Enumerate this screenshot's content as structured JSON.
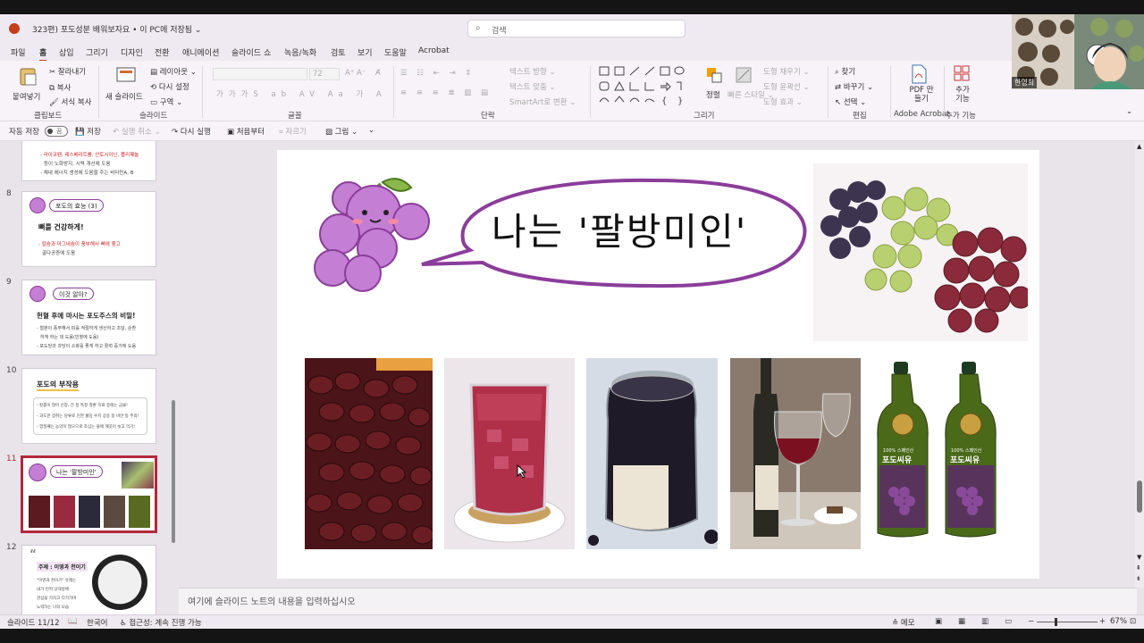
{
  "window": {
    "title": "323편) 포도성분 배워보자요 • 이 PC에 저장됨 ⌄",
    "search_placeholder": "검색"
  },
  "menu": [
    "파일",
    "홈",
    "삽입",
    "그리기",
    "디자인",
    "전환",
    "애니메이션",
    "슬라이드 쇼",
    "녹음/녹화",
    "검토",
    "보기",
    "도움말",
    "Acrobat"
  ],
  "ribbon": {
    "paste": "붙여넣기",
    "cut": "잘라내기",
    "copy": "복사",
    "format_painter": "서식 복사",
    "new_slide": "새 슬라이드",
    "layout": "레이아웃 ⌄",
    "reset": "다시 설정",
    "section": "구역 ⌄",
    "font_size": "72",
    "text_direction": "텍스트 방향 ⌄",
    "align_text": "텍스트 맞춤 ⌄",
    "smartart": "SmartArt로 변환 ⌄",
    "arrange": "정렬",
    "quick_styles": "빠른 스타일 ⌄",
    "shape_fill": "도형 채우기 ⌄",
    "shape_outline": "도형 윤곽선 ⌄",
    "shape_effects": "도형 효과 ⌄",
    "find": "찾기",
    "replace": "바꾸기 ⌄",
    "select": "선택 ⌄",
    "pdf": "PDF 만들기",
    "addins": "추가 기능",
    "groups": {
      "clipboard": "클립보드",
      "slides": "슬라이드",
      "font": "글꼴",
      "paragraph": "단락",
      "drawing": "그리기",
      "editing": "편집",
      "acrobat": "Adobe Acrobat",
      "addins": "추가 기능"
    }
  },
  "qat": {
    "autosave": "자동 저장",
    "autosave_state": "끔",
    "save": "저장",
    "undo": "실행 취소",
    "redo": "다시 실행",
    "from_start": "처음부터",
    "crop": "자르기",
    "picture": "그림"
  },
  "thumbs": {
    "t7_line1": "- 라이코펜, 레스베라트롤, 안토시아닌, 폴리페놀",
    "t7_line2": "등이 노화방지, 시력 개선에 도움",
    "t7_line3": "- 체내 에너지 생성에 도움을 주는 비타민A, B",
    "n8": "8",
    "t8_pill": "포도의 효능 (3)",
    "t8_head": "뼈를 건강하게!",
    "t8_line1": "- 칼슘과 마그네슘이 풍부해서 뼈에 좋고",
    "t8_line2": "골다공증에 도움",
    "n9": "9",
    "t9_pill": "이것 알아?",
    "t9_head": "헌혈 후에 마시는 포도주스의 비밀!",
    "t9_line1": "- 철분이 풍부해서 피를 적절하게 생산하고 조달, 순환",
    "t9_line2": "하게 하는 데 도움(빈혈에 도움)",
    "t9_line3": "- 포도당과 과당이 소화를 좋게 하고 활력 증가에 도움",
    "n10": "10",
    "t10_head": "포도의 부작용",
    "t10_line1": "- 칼륨이 많아 신장, 간 등 특정 질환 치료 중에는 금물!",
    "t10_line2": "- 과도한 섭취는 당류로 인한 혈당 수치 상승 등 비만 등 주의!",
    "t10_line3": "- 껍질째는 농약이 많으므로 조심는 물에 깨끗이 씻고 먹기!",
    "n11": "11",
    "t11_text": "나는 '팔방미인'",
    "n12": "12",
    "t12_head": "주제 : 이영과 천이기",
    "t12_line1": "\"이영과 천이기\" 유래는",
    "t12_line2": "내가 먼저 상대방에",
    "t12_line3": "관심을 가지고 다가가며",
    "t12_line4": "노력하는 나의 모습"
  },
  "slide": {
    "title": "나는 '팔방미인'",
    "juice_label_1": "100% 스페인산",
    "juice_label_2": "포도씨유"
  },
  "notes_placeholder": "여기에 슬라이드 노트의 내용을 입력하십시오",
  "status": {
    "slide": "슬라이드 11/12",
    "language": "한국어",
    "accessibility": "접근성: 계속 진행 가능",
    "notes": "메모",
    "zoom": "67%"
  },
  "video": {
    "name": "한영희"
  }
}
